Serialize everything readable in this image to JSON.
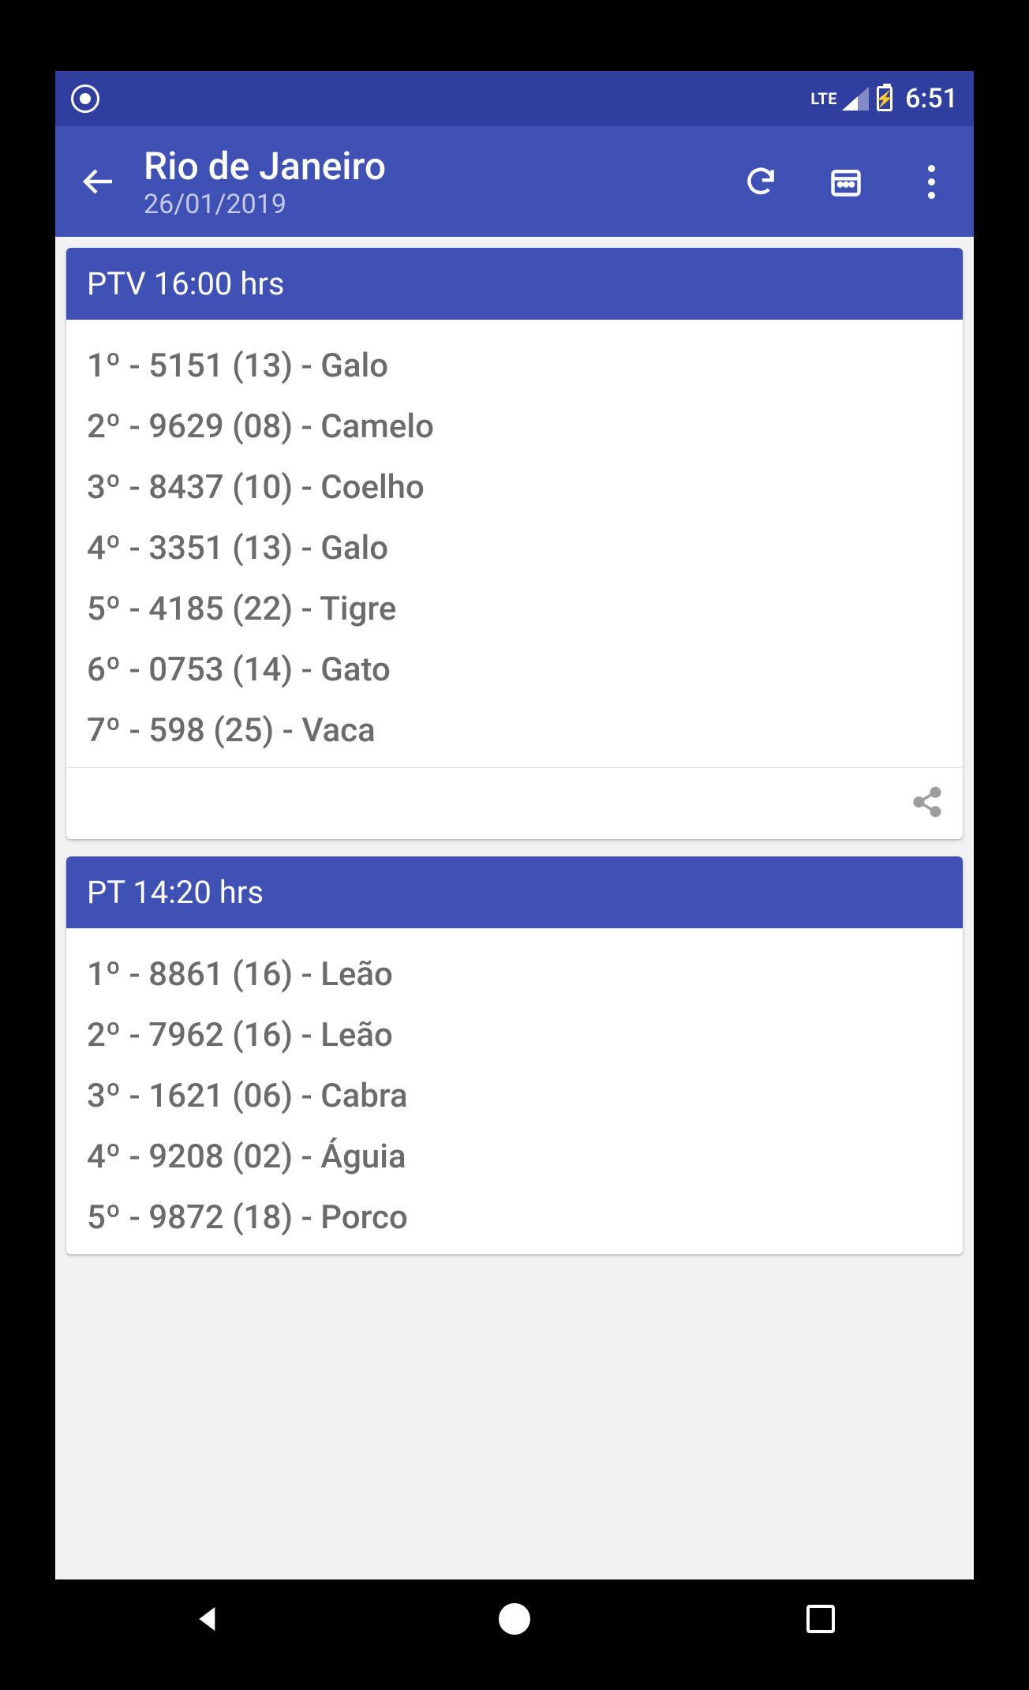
{
  "status": {
    "clock": "6:51",
    "lte": "LTE"
  },
  "appbar": {
    "title": "Rio de Janeiro",
    "subtitle": "26/01/2019"
  },
  "cards": [
    {
      "header": "PTV 16:00 hrs",
      "rows": [
        "1º - 5151 (13) - Galo",
        "2º - 9629 (08) - Camelo",
        "3º - 8437 (10) - Coelho",
        "4º - 3351 (13) - Galo",
        "5º - 4185 (22) - Tigre",
        "6º - 0753 (14) - Gato",
        "7º - 598 (25) - Vaca"
      ]
    },
    {
      "header": "PT  14:20 hrs",
      "rows": [
        "1º - 8861 (16) - Leão",
        "2º - 7962 (16) - Leão",
        "3º - 1621 (06) - Cabra",
        "4º - 9208 (02) - Águia",
        "5º - 9872 (18) - Porco"
      ]
    }
  ]
}
